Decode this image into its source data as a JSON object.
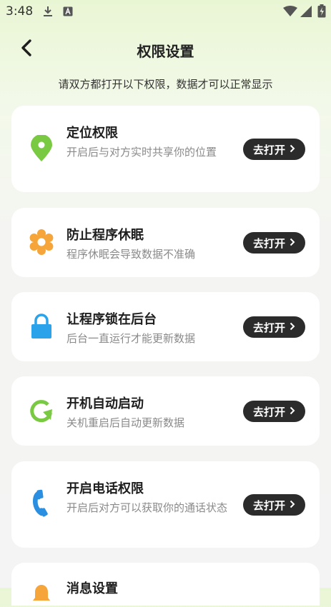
{
  "status": {
    "time": "3:48"
  },
  "header": {
    "title": "权限设置"
  },
  "subtitle": "请双方都打开以下权限，数据才可以正常显示",
  "items": [
    {
      "title": "定位权限",
      "desc": "开启后与对方实时共享你的位置",
      "button": "去打开",
      "icon": "location-pin-icon",
      "color": "#7ac943"
    },
    {
      "title": "防止程序休眠",
      "desc": "程序休眠会导致数据不准确",
      "button": "去打开",
      "icon": "gear-icon",
      "color": "#f5a53a"
    },
    {
      "title": "让程序锁在后台",
      "desc": "后台一直运行才能更新数据",
      "button": "去打开",
      "icon": "lock-icon",
      "color": "#2aa3ea"
    },
    {
      "title": "开机自动启动",
      "desc": "关机重启后自动更新数据",
      "button": "去打开",
      "icon": "refresh-icon",
      "color": "#7ac943"
    },
    {
      "title": "开启电话权限",
      "desc": "开启后对方可以获取你的通话状态",
      "button": "去打开",
      "icon": "phone-icon",
      "color": "#2a8fe0"
    },
    {
      "title": "消息设置",
      "icon": "bell-icon",
      "color": "#f5a53a"
    }
  ]
}
